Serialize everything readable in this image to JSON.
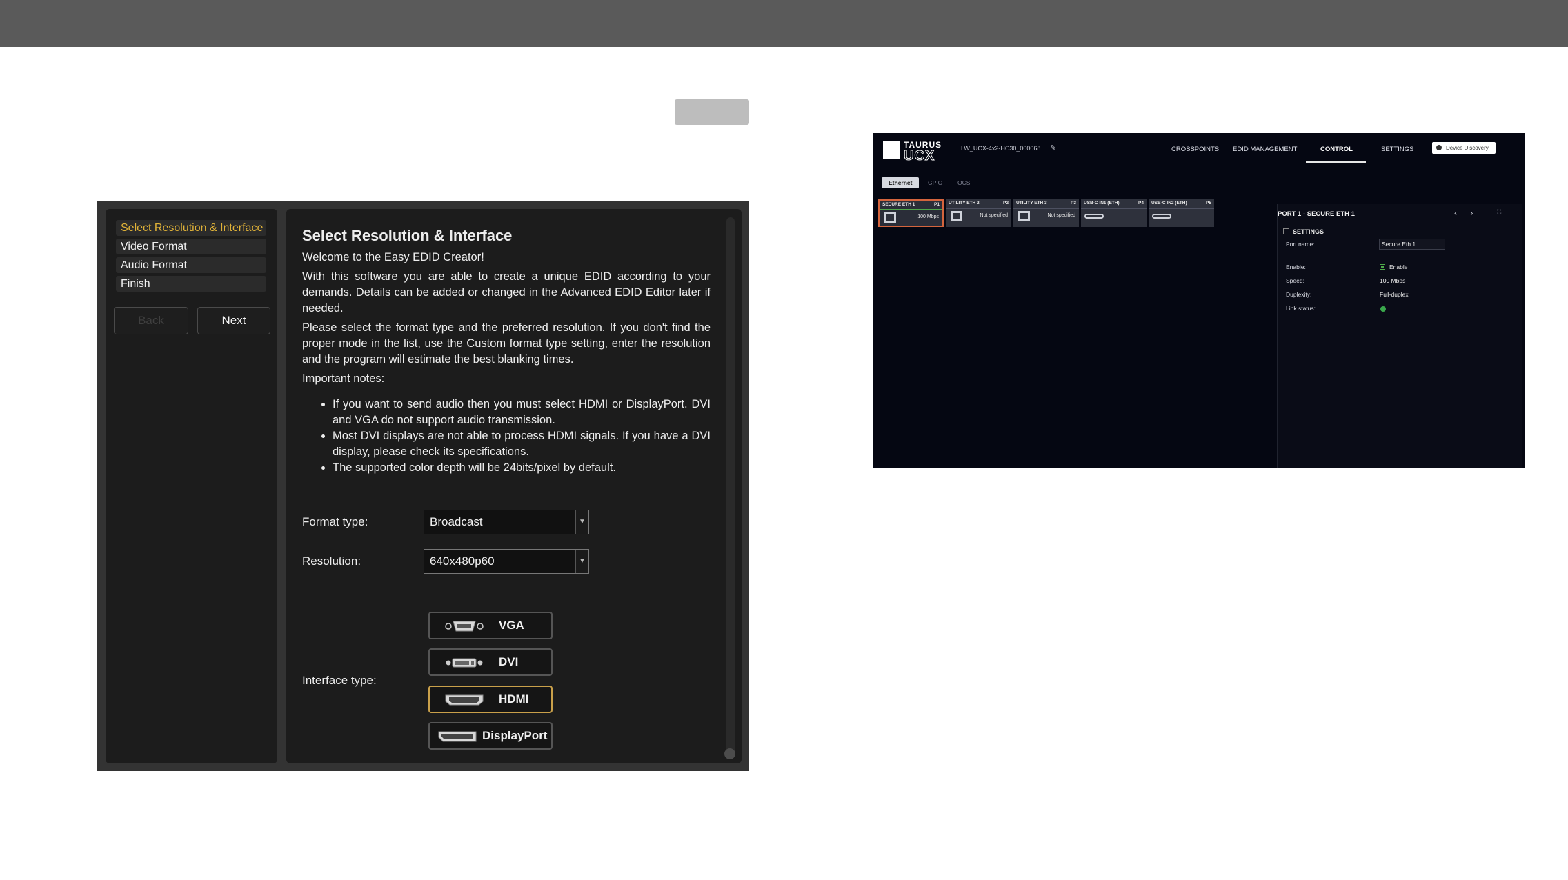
{
  "edid_creator": {
    "steps": [
      "Select Resolution & Interface",
      "Video Format",
      "Audio Format",
      "Finish"
    ],
    "back_label": "Back",
    "next_label": "Next",
    "title": "Select Resolution & Interface",
    "welcome": "Welcome to the Easy EDID Creator!",
    "para1": "With this software you are able to create a unique EDID according to your demands. Details can be added or changed in the Advanced EDID Editor later if needed.",
    "para2": "Please select the format type and the preferred resolution. If you don't find the proper mode in the list, use the Custom format type setting, enter the resolution and the program will estimate the best blanking times.",
    "important": "Important notes:",
    "notes": [
      "If you want to send audio then you must select HDMI or DisplayPort. DVI and VGA do not support audio transmission.",
      "Most DVI displays are not able to process HDMI signals. If you have a DVI display, please check its specifications.",
      "The supported color depth will be 24bits/pixel by default."
    ],
    "format_type_label": "Format type:",
    "format_type_value": "Broadcast",
    "resolution_label": "Resolution:",
    "resolution_value": "640x480p60",
    "interface_label": "Interface type:",
    "interfaces": [
      "VGA",
      "DVI",
      "HDMI",
      "DisplayPort"
    ],
    "selected_interface": "HDMI",
    "accent_color": "#e0b238"
  },
  "taurus": {
    "logo_top": "TAURUS",
    "logo_bottom": "UCX",
    "device_name": "LW_UCX-4x2-HC30_000068...",
    "nav": [
      "CROSSPOINTS",
      "EDID MANAGEMENT",
      "CONTROL",
      "SETTINGS"
    ],
    "active_nav": "CONTROL",
    "discovery_label": "Device Discovery",
    "subtabs": [
      "Ethernet",
      "GPIO",
      "OCS"
    ],
    "ports": [
      {
        "name": "SECURE ETH 1",
        "num": "P1",
        "status": "100 Mbps"
      },
      {
        "name": "UTILITY ETH 2",
        "num": "P2",
        "status": "Not specified"
      },
      {
        "name": "UTILITY ETH 3",
        "num": "P3",
        "status": "Not specified"
      },
      {
        "name": "USB-C IN1 (ETH)",
        "num": "P4",
        "status": ""
      },
      {
        "name": "USB-C IN2 (ETH)",
        "num": "P5",
        "status": ""
      }
    ],
    "panel": {
      "title": "PORT 1 - SECURE ETH 1",
      "arrows": "‹ ›",
      "settings_heading": "SETTINGS",
      "port_name_label": "Port name:",
      "port_name_value": "Secure Eth 1",
      "enable_label": "Enable:",
      "enable_value": "Enable",
      "speed_label": "Speed:",
      "speed_value": "100 Mbps",
      "duplexity_label": "Duplexity:",
      "duplexity_value": "Full-duplex",
      "link_status_label": "Link status:",
      "link_color": "#3aa84c"
    }
  }
}
